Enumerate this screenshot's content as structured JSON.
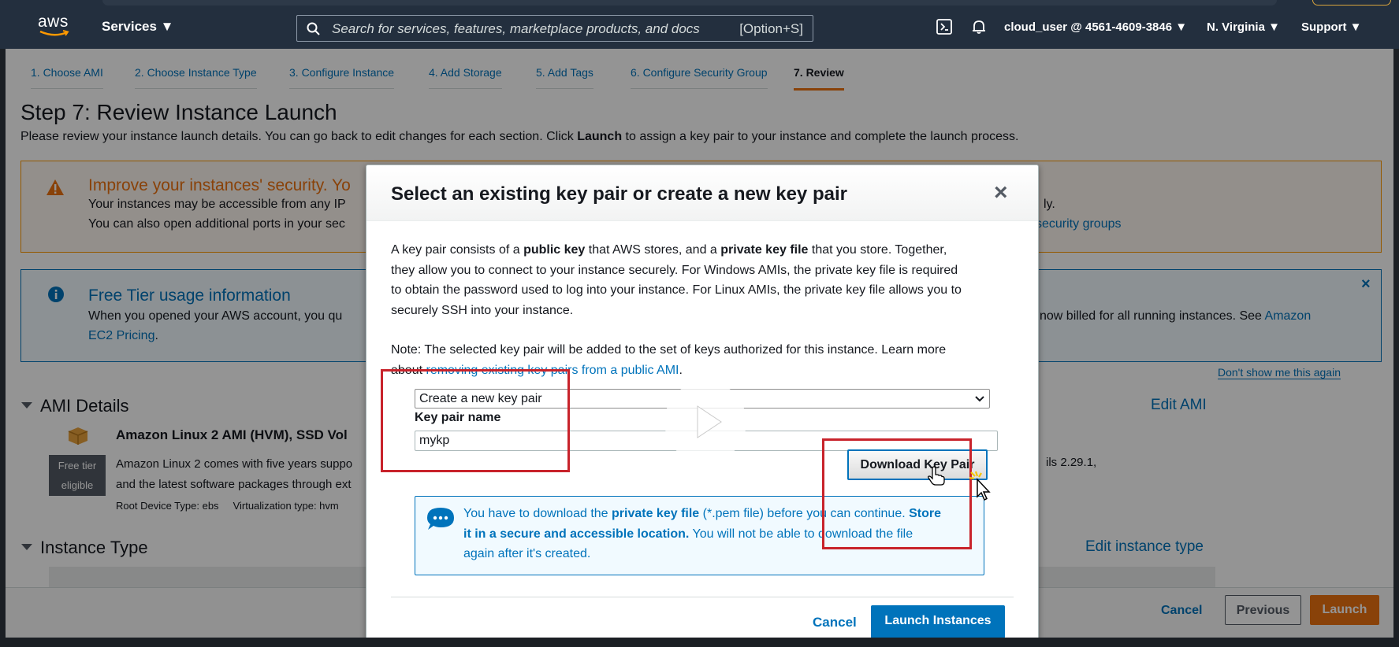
{
  "nav": {
    "logo": "aws",
    "services": "Services ▼",
    "search_placeholder": "Search for services, features, marketplace products, and docs",
    "search_shortcut": "[Option+S]",
    "account": "cloud_user @ 4561-4609-3846 ▼",
    "region": "N. Virginia ▼",
    "support": "Support ▼"
  },
  "tabs": [
    {
      "label": "1. Choose AMI"
    },
    {
      "label": "2. Choose Instance Type"
    },
    {
      "label": "3. Configure Instance"
    },
    {
      "label": "4. Add Storage"
    },
    {
      "label": "5. Add Tags"
    },
    {
      "label": "6. Configure Security Group"
    },
    {
      "label": "7. Review"
    }
  ],
  "page": {
    "title": "Step 7: Review Instance Launch",
    "desc_prefix": "Please review your instance launch details. You can go back to edit changes for each section. Click ",
    "desc_bold": "Launch",
    "desc_suffix": " to assign a key pair to your instance and complete the launch process."
  },
  "warning": {
    "title": "Improve your instances' security. Yo",
    "line1_left": "Your instances may be accessible from any IP",
    "line1_right": "ly.",
    "line2_left": "You can also open additional ports in your sec",
    "line2_link": "security groups"
  },
  "freetier": {
    "title": "Free Tier usage information",
    "line1_left": "When you opened your AWS account, you qu",
    "line1_right": "now billed for all running instances. See ",
    "line1_link": "Amazon",
    "line2_link": "EC2 Pricing",
    "line2_end": ".",
    "dont_show": "Don't show me this again",
    "close": "×"
  },
  "ami": {
    "section": "AMI Details",
    "edit": "Edit AMI",
    "name": "Amazon Linux 2 AMI (HVM), SSD Vol",
    "badge_line1": "Free tier",
    "badge_line2": "eligible",
    "desc1": "Amazon Linux 2 comes with five years suppo",
    "desc2": "and the latest software packages through ext",
    "version": "ils 2.29.1,",
    "root": "Root Device Type: ebs",
    "virt": "Virtualization type: hvm"
  },
  "instance_type": {
    "section": "Instance Type",
    "edit": "Edit instance type"
  },
  "footer": {
    "cancel": "Cancel",
    "previous": "Previous",
    "launch": "Launch"
  },
  "modal": {
    "title": "Select an existing key pair or create a new key pair",
    "close": "×",
    "p1_l1_a": "A key pair consists of a ",
    "p1_l1_b": "public key",
    "p1_l1_c": " that AWS stores, and a ",
    "p1_l1_d": "private key file",
    "p1_l1_e": " that you store. Together,",
    "p1_l2": "they allow you to connect to your instance securely. For Windows AMIs, the private key file is required",
    "p1_l3": "to obtain the password used to log into your instance. For Linux AMIs, the private key file allows you to",
    "p1_l4": "securely SSH into your instance.",
    "note_l1": "Note: The selected key pair will be added to the set of keys authorized for this instance. Learn more",
    "note_l2_a": "about ",
    "note_l2_link": "removing existing key pairs from a public AMI",
    "note_l2_b": ".",
    "select_value": "Create a new key pair",
    "kp_label": "Key pair name",
    "kp_value": "mykp",
    "download": "Download Key Pair",
    "info_l1_a": "You have to download the ",
    "info_l1_b": "private key file",
    "info_l1_c": " (*.pem file) before you can continue. ",
    "info_l1_d": "Store",
    "info_l2_bold": "it in a secure and accessible location.",
    "info_l2_rest": " You will not be able to download the file",
    "info_l3": "again after it's created.",
    "cancel": "Cancel",
    "launch": "Launch Instances"
  },
  "colors": {
    "nav_bg": "#232f3e",
    "link": "#0073bb",
    "orange": "#ec7211",
    "annotation_red": "#c8232b"
  }
}
